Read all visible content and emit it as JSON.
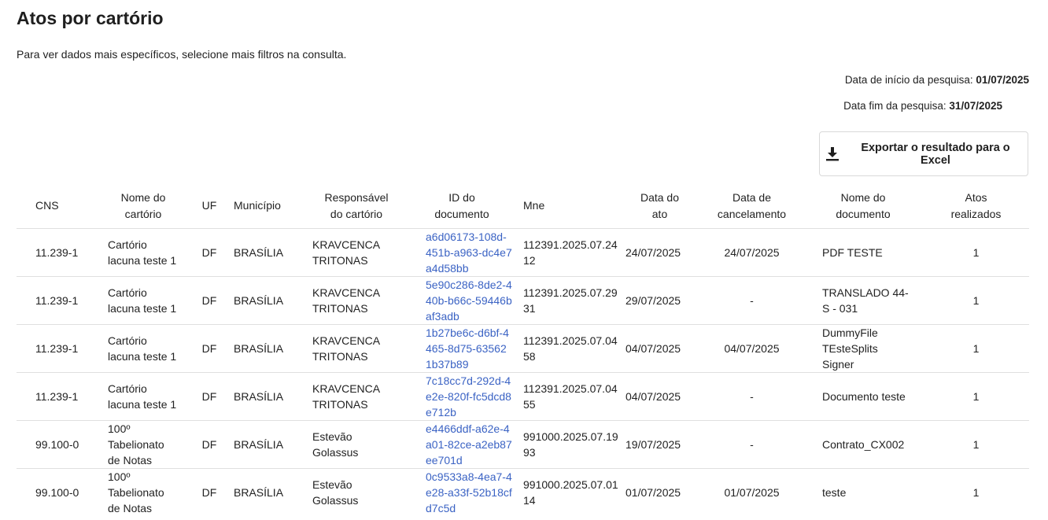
{
  "page": {
    "title": "Atos por cartório",
    "subtitle": "Para ver dados mais específicos, selecione mais filtros na consulta.",
    "start_label": "Data de início da pesquisa: ",
    "start_value": "01/07/2025",
    "end_label": "Data fim da pesquisa: ",
    "end_value": "31/07/2025",
    "export_label": "Exportar o resultado para o Excel",
    "export_icon": "download-icon"
  },
  "table": {
    "headers": [
      "CNS",
      "Nome do cartório",
      "UF",
      "Município",
      "Responsável do cartório",
      "ID do documento",
      "Mne",
      "Data do ato",
      "Data de cancelamento",
      "Nome do documento",
      "Atos realizados"
    ],
    "rows": [
      [
        "11.239-1",
        "Cartório lacuna teste 1",
        "DF",
        "BRASÍLIA",
        "KRAVCENCA TRITONAS",
        "a6d06173-108d-451b-a963-dc4e7a4d58bb",
        "112391.2025.07.2412",
        "24/07/2025",
        "24/07/2025",
        "PDF TESTE",
        "1"
      ],
      [
        "11.239-1",
        "Cartório lacuna teste 1",
        "DF",
        "BRASÍLIA",
        "KRAVCENCA TRITONAS",
        "5e90c286-8de2-440b-b66c-59446baf3adb",
        "112391.2025.07.2931",
        "29/07/2025",
        "-",
        "TRANSLADO 44-S - 031",
        "1"
      ],
      [
        "11.239-1",
        "Cartório lacuna teste 1",
        "DF",
        "BRASÍLIA",
        "KRAVCENCA TRITONAS",
        "1b27be6c-d6bf-4465-8d75-635621b37b89",
        "112391.2025.07.0458",
        "04/07/2025",
        "04/07/2025",
        "DummyFile TEsteSplits Signer",
        "1"
      ],
      [
        "11.239-1",
        "Cartório lacuna teste 1",
        "DF",
        "BRASÍLIA",
        "KRAVCENCA TRITONAS",
        "7c18cc7d-292d-4e2e-820f-fc5dcd8e712b",
        "112391.2025.07.0455",
        "04/07/2025",
        "-",
        "Documento teste",
        "1"
      ],
      [
        "99.100-0",
        "100º Tabelionato de Notas",
        "DF",
        "BRASÍLIA",
        "Estevão Golassus",
        "e4466ddf-a62e-4a01-82ce-a2eb87ee701d",
        "991000.2025.07.1993",
        "19/07/2025",
        "-",
        "Contrato_CX002",
        "1"
      ],
      [
        "99.100-0",
        "100º Tabelionato de Notas",
        "DF",
        "BRASÍLIA",
        "Estevão Golassus",
        "0c9533a8-4ea7-4e28-a33f-52b18cfd7c5d",
        "991000.2025.07.0114",
        "01/07/2025",
        "01/07/2025",
        "teste",
        "1"
      ]
    ]
  }
}
